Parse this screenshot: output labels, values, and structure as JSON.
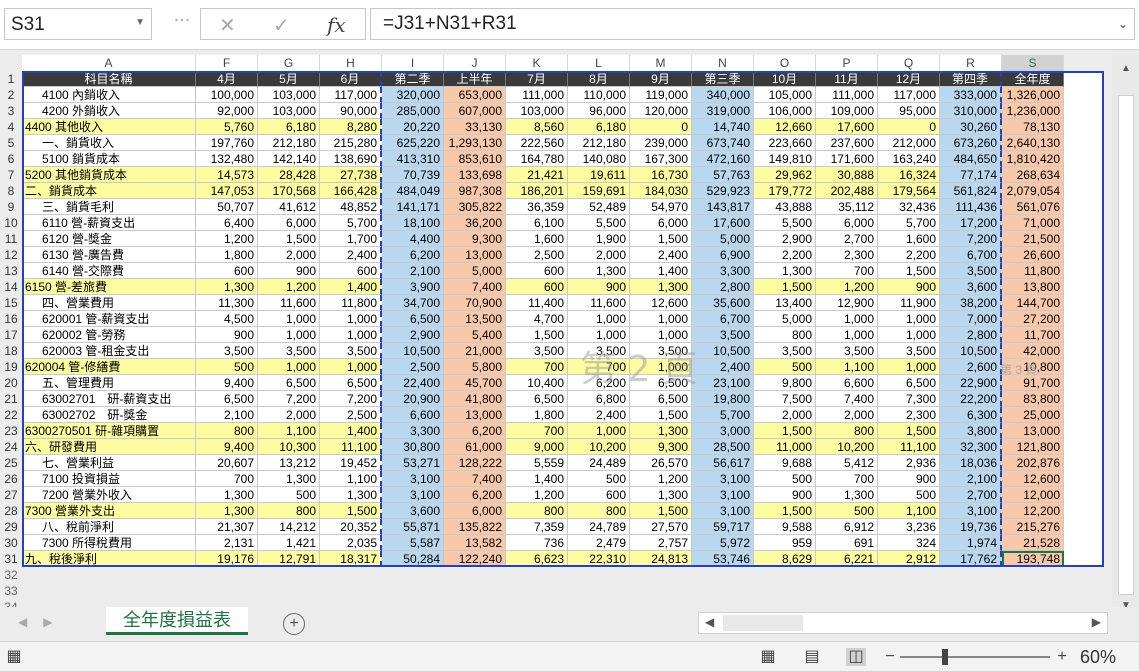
{
  "namebox": {
    "value": "S31"
  },
  "formula": {
    "value": "=J31+N31+R31",
    "fx": "fx"
  },
  "columns": [
    "A",
    "F",
    "G",
    "H",
    "I",
    "J",
    "K",
    "L",
    "M",
    "N",
    "O",
    "P",
    "Q",
    "R",
    "S"
  ],
  "row_numbers": [
    "1",
    "2",
    "3",
    "4",
    "5",
    "6",
    "7",
    "8",
    "9",
    "10",
    "11",
    "12",
    "13",
    "14",
    "15",
    "16",
    "17",
    "18",
    "19",
    "20",
    "21",
    "22",
    "23",
    "24",
    "25",
    "26",
    "27",
    "28",
    "29",
    "30",
    "31",
    "32",
    "33",
    "34"
  ],
  "header": [
    "科目名稱",
    "4月",
    "5月",
    "6月",
    "第二季",
    "上半年",
    "7月",
    "8月",
    "9月",
    "第三季",
    "10月",
    "11月",
    "12月",
    "第四季",
    "全年度"
  ],
  "rows": [
    [
      "4100 內銷收入",
      "100,000",
      "103,000",
      "117,000",
      "320,000",
      "653,000",
      "111,000",
      "110,000",
      "119,000",
      "340,000",
      "105,000",
      "111,000",
      "117,000",
      "333,000",
      "1,326,000"
    ],
    [
      "4200 外銷收入",
      "92,000",
      "103,000",
      "90,000",
      "285,000",
      "607,000",
      "103,000",
      "96,000",
      "120,000",
      "319,000",
      "106,000",
      "109,000",
      "95,000",
      "310,000",
      "1,236,000"
    ],
    [
      "4400 其他收入",
      "5,760",
      "6,180",
      "8,280",
      "20,220",
      "33,130",
      "8,560",
      "6,180",
      "0",
      "14,740",
      "12,660",
      "17,600",
      "0",
      "30,260",
      "78,130"
    ],
    [
      "一、銷貨收入",
      "197,760",
      "212,180",
      "215,280",
      "625,220",
      "1,293,130",
      "222,560",
      "212,180",
      "239,000",
      "673,740",
      "223,660",
      "237,600",
      "212,000",
      "673,260",
      "2,640,130"
    ],
    [
      "5100 銷貨成本",
      "132,480",
      "142,140",
      "138,690",
      "413,310",
      "853,610",
      "164,780",
      "140,080",
      "167,300",
      "472,160",
      "149,810",
      "171,600",
      "163,240",
      "484,650",
      "1,810,420"
    ],
    [
      "5200 其他銷貨成本",
      "14,573",
      "28,428",
      "27,738",
      "70,739",
      "133,698",
      "21,421",
      "19,611",
      "16,730",
      "57,763",
      "29,962",
      "30,888",
      "16,324",
      "77,174",
      "268,634"
    ],
    [
      "二、銷貨成本",
      "147,053",
      "170,568",
      "166,428",
      "484,049",
      "987,308",
      "186,201",
      "159,691",
      "184,030",
      "529,923",
      "179,772",
      "202,488",
      "179,564",
      "561,824",
      "2,079,054"
    ],
    [
      "三、銷貨毛利",
      "50,707",
      "41,612",
      "48,852",
      "141,171",
      "305,822",
      "36,359",
      "52,489",
      "54,970",
      "143,817",
      "43,888",
      "35,112",
      "32,436",
      "111,436",
      "561,076"
    ],
    [
      "6110 營-薪資支出",
      "6,400",
      "6,000",
      "5,700",
      "18,100",
      "36,200",
      "6,100",
      "5,500",
      "6,000",
      "17,600",
      "5,500",
      "6,000",
      "5,700",
      "17,200",
      "71,000"
    ],
    [
      "6120 營-獎金",
      "1,200",
      "1,500",
      "1,700",
      "4,400",
      "9,300",
      "1,600",
      "1,900",
      "1,500",
      "5,000",
      "2,900",
      "2,700",
      "1,600",
      "7,200",
      "21,500"
    ],
    [
      "6130 營-廣告費",
      "1,800",
      "2,000",
      "2,400",
      "6,200",
      "13,000",
      "2,500",
      "2,000",
      "2,400",
      "6,900",
      "2,200",
      "2,300",
      "2,200",
      "6,700",
      "26,600"
    ],
    [
      "6140 營-交際費",
      "600",
      "900",
      "600",
      "2,100",
      "5,000",
      "600",
      "1,300",
      "1,400",
      "3,300",
      "1,300",
      "700",
      "1,500",
      "3,500",
      "11,800"
    ],
    [
      "6150 營-差旅費",
      "1,300",
      "1,200",
      "1,400",
      "3,900",
      "7,400",
      "600",
      "900",
      "1,300",
      "2,800",
      "1,500",
      "1,200",
      "900",
      "3,600",
      "13,800"
    ],
    [
      "四、營業費用",
      "11,300",
      "11,600",
      "11,800",
      "34,700",
      "70,900",
      "11,400",
      "11,600",
      "12,600",
      "35,600",
      "13,400",
      "12,900",
      "11,900",
      "38,200",
      "144,700"
    ],
    [
      "620001 管-薪資支出",
      "4,500",
      "1,000",
      "1,000",
      "6,500",
      "13,500",
      "4,700",
      "1,000",
      "1,000",
      "6,700",
      "5,000",
      "1,000",
      "1,000",
      "7,000",
      "27,200"
    ],
    [
      "620002 管-勞務",
      "900",
      "1,000",
      "1,000",
      "2,900",
      "5,400",
      "1,500",
      "1,000",
      "1,000",
      "3,500",
      "800",
      "1,000",
      "1,000",
      "2,800",
      "11,700"
    ],
    [
      "620003 管-租金支出",
      "3,500",
      "3,500",
      "3,500",
      "10,500",
      "21,000",
      "3,500",
      "3,500",
      "3,500",
      "10,500",
      "3,500",
      "3,500",
      "3,500",
      "10,500",
      "42,000"
    ],
    [
      "620004 管-修繕費",
      "500",
      "1,000",
      "1,000",
      "2,500",
      "5,800",
      "700",
      "700",
      "1,000",
      "2,400",
      "500",
      "1,100",
      "1,000",
      "2,600",
      "10,800"
    ],
    [
      "五、管理費用",
      "9,400",
      "6,500",
      "6,500",
      "22,400",
      "45,700",
      "10,400",
      "6,200",
      "6,500",
      "23,100",
      "9,800",
      "6,600",
      "6,500",
      "22,900",
      "91,700"
    ],
    [
      "63002701　研-薪資支出",
      "6,500",
      "7,200",
      "7,200",
      "20,900",
      "41,800",
      "6,500",
      "6,800",
      "6,500",
      "19,800",
      "7,500",
      "7,400",
      "7,300",
      "22,200",
      "83,800"
    ],
    [
      "63002702　研-獎金",
      "2,100",
      "2,000",
      "2,500",
      "6,600",
      "13,000",
      "1,800",
      "2,400",
      "1,500",
      "5,700",
      "2,000",
      "2,000",
      "2,300",
      "6,300",
      "25,000"
    ],
    [
      "6300270501 研-雜項購置",
      "800",
      "1,100",
      "1,400",
      "3,300",
      "6,200",
      "700",
      "1,000",
      "1,300",
      "3,000",
      "1,500",
      "800",
      "1,500",
      "3,800",
      "13,000"
    ],
    [
      "六、研發費用",
      "9,400",
      "10,300",
      "11,100",
      "30,800",
      "61,000",
      "9,000",
      "10,200",
      "9,300",
      "28,500",
      "11,000",
      "10,200",
      "11,100",
      "32,300",
      "121,800"
    ],
    [
      "七、營業利益",
      "20,607",
      "13,212",
      "19,452",
      "53,271",
      "128,222",
      "5,559",
      "24,489",
      "26,570",
      "56,617",
      "9,688",
      "5,412",
      "2,936",
      "18,036",
      "202,876"
    ],
    [
      "7100 投資損益",
      "700",
      "1,300",
      "1,100",
      "3,100",
      "7,400",
      "1,400",
      "500",
      "1,200",
      "3,100",
      "500",
      "700",
      "900",
      "2,100",
      "12,600"
    ],
    [
      "7200 營業外收入",
      "1,300",
      "500",
      "1,300",
      "3,100",
      "6,200",
      "1,200",
      "600",
      "1,300",
      "3,100",
      "900",
      "1,300",
      "500",
      "2,700",
      "12,000"
    ],
    [
      "7300 營業外支出",
      "1,300",
      "800",
      "1,500",
      "3,600",
      "6,000",
      "800",
      "800",
      "1,500",
      "3,100",
      "1,500",
      "500",
      "1,100",
      "3,100",
      "12,200"
    ],
    [
      "八、稅前淨利",
      "21,307",
      "14,212",
      "20,352",
      "55,871",
      "135,822",
      "7,359",
      "24,789",
      "27,570",
      "59,717",
      "9,588",
      "6,912",
      "3,236",
      "19,736",
      "215,276"
    ],
    [
      "7300 所得稅費用",
      "2,131",
      "1,421",
      "2,035",
      "5,587",
      "13,582",
      "736",
      "2,479",
      "2,757",
      "5,972",
      "959",
      "691",
      "324",
      "1,974",
      "21,528"
    ],
    [
      "九、稅後淨利",
      "19,176",
      "12,791",
      "18,317",
      "50,284",
      "122,240",
      "6,623",
      "22,310",
      "24,813",
      "53,746",
      "8,629",
      "6,221",
      "2,912",
      "17,762",
      "193,748"
    ]
  ],
  "yellow_rows": [
    4,
    7,
    8,
    14,
    19,
    23,
    24,
    28,
    31
  ],
  "watermark": "第 2 頁",
  "page_label": "第 3 頁",
  "sheet_tab": "全年度損益表",
  "zoom": "60%",
  "colors": {
    "header": "#3a3a3a",
    "quarter": "#b9d7ee",
    "half": "#f8c8ab",
    "highlight": "#fdfca0",
    "accent": "#217346"
  }
}
